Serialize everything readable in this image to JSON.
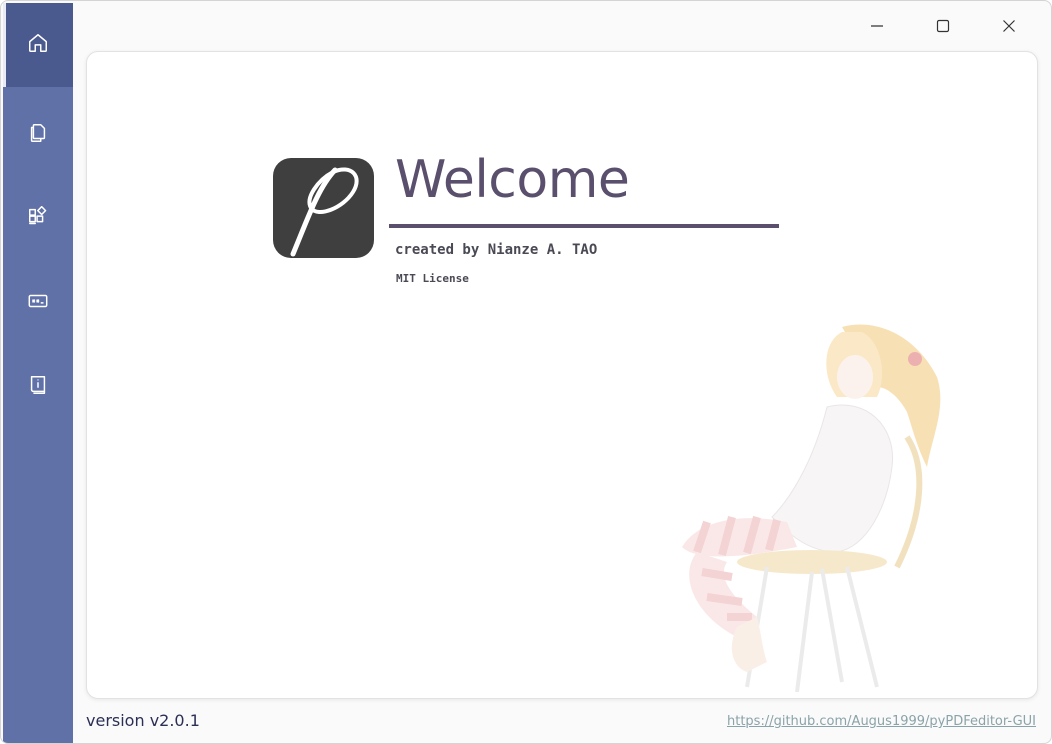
{
  "sidebar": {
    "items": [
      {
        "icon": "home-icon",
        "active": true
      },
      {
        "icon": "document-icon",
        "active": false
      },
      {
        "icon": "apps-icon",
        "active": false
      },
      {
        "icon": "terminal-icon",
        "active": false
      },
      {
        "icon": "info-icon",
        "active": false
      }
    ]
  },
  "window_controls": {
    "minimize": "minimize-icon",
    "maximize": "maximize-icon",
    "close": "close-icon"
  },
  "main": {
    "welcome_title": "Welcome",
    "author": "created by Nianze A. TAO",
    "license": "MIT License",
    "accent_color": "#5a4f6d"
  },
  "footer": {
    "version": "version v2.0.1",
    "repo_link": "https://github.com/Augus1999/pyPDFeditor-GUI"
  },
  "colors": {
    "sidebar": "#6071a8",
    "sidebar_active": "#4b5a8e",
    "icon": "#ffffff"
  }
}
